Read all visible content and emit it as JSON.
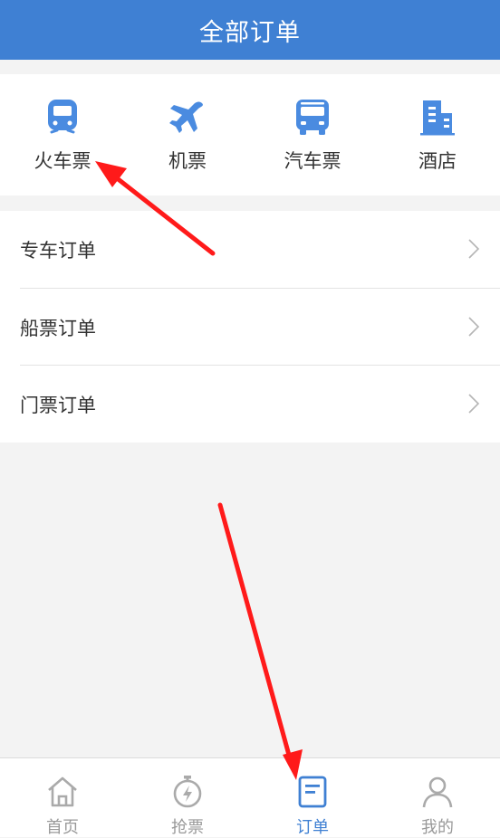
{
  "header": {
    "title": "全部订单"
  },
  "categories": [
    {
      "label": "火车票",
      "icon": "train-icon"
    },
    {
      "label": "机票",
      "icon": "airplane-icon"
    },
    {
      "label": "汽车票",
      "icon": "bus-icon"
    },
    {
      "label": "酒店",
      "icon": "hotel-icon"
    }
  ],
  "orders": [
    {
      "label": "专车订单"
    },
    {
      "label": "船票订单"
    },
    {
      "label": "门票订单"
    }
  ],
  "tabbar": {
    "items": [
      {
        "label": "首页",
        "icon": "home-icon"
      },
      {
        "label": "抢票",
        "icon": "stopwatch-icon"
      },
      {
        "label": "订单",
        "icon": "order-icon",
        "active": true
      },
      {
        "label": "我的",
        "icon": "profile-icon"
      }
    ]
  },
  "colors": {
    "accent": "#3f80d3",
    "icon_blue": "#4a8be0",
    "arrow": "#ff1a1a",
    "inactive": "#999999"
  }
}
